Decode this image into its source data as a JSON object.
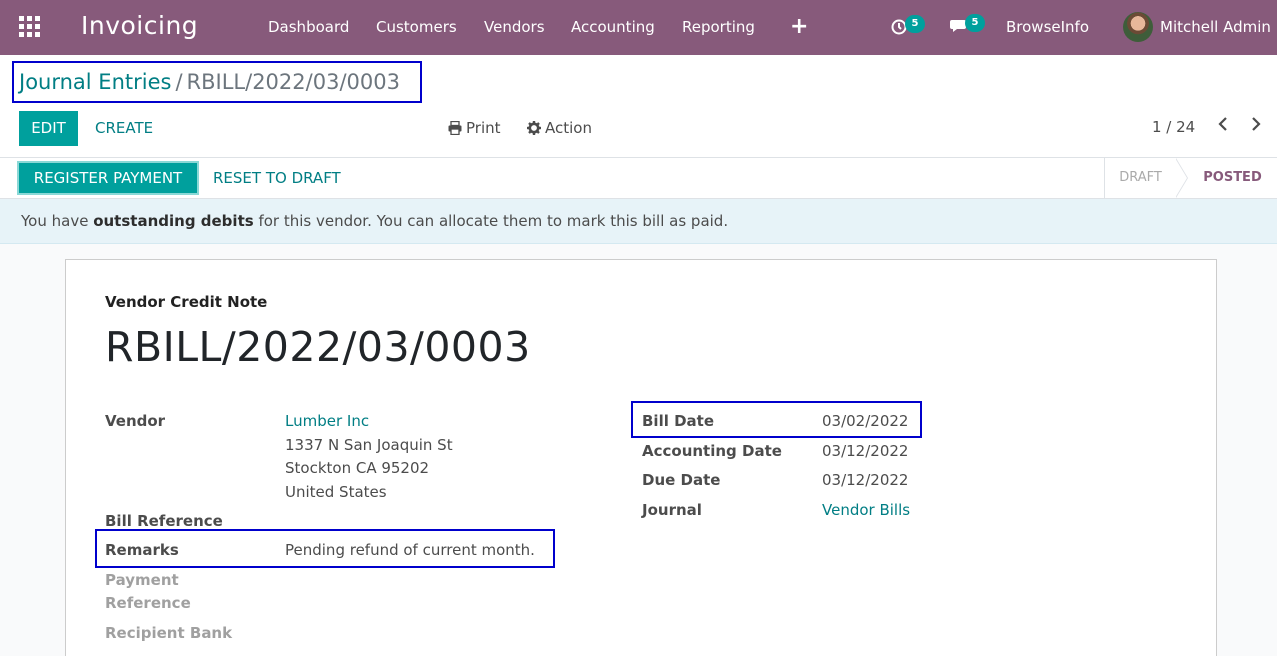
{
  "navbar": {
    "app_title": "Invoicing",
    "menu": [
      "Dashboard",
      "Customers",
      "Vendors",
      "Accounting",
      "Reporting"
    ],
    "activity_count": "5",
    "messages_count": "5",
    "company": "BrowseInfo",
    "user": "Mitchell Admin"
  },
  "breadcrumb": {
    "parent": "Journal Entries",
    "separator": "/",
    "current": "RBILL/2022/03/0003"
  },
  "buttons": {
    "edit": "EDIT",
    "create": "CREATE",
    "print": "Print",
    "action": "Action"
  },
  "pager": {
    "value": "1 / 24"
  },
  "statusbar": {
    "register_payment": "REGISTER PAYMENT",
    "reset_to_draft": "RESET TO DRAFT",
    "stages": [
      "DRAFT",
      "POSTED"
    ],
    "active_stage": "POSTED"
  },
  "alert": {
    "prefix": "You have ",
    "bold": "outstanding debits",
    "suffix": " for this vendor. You can allocate them to mark this bill as paid."
  },
  "document": {
    "type": "Vendor Credit Note",
    "name": "RBILL/2022/03/0003",
    "left": {
      "vendor_label": "Vendor",
      "vendor_name": "Lumber Inc",
      "address_line1": "1337 N San Joaquin St",
      "address_line2": "Stockton CA 95202",
      "address_line3": "United States",
      "bill_reference_label": "Bill Reference",
      "remarks_label": "Remarks",
      "remarks_value": "Pending refund of current month.",
      "payment_reference_label_1": "Payment",
      "payment_reference_label_2": "Reference",
      "recipient_bank_label": "Recipient Bank"
    },
    "right": {
      "bill_date_label": "Bill Date",
      "bill_date": "03/02/2022",
      "accounting_date_label": "Accounting Date",
      "accounting_date": "03/12/2022",
      "due_date_label": "Due Date",
      "due_date": "03/12/2022",
      "journal_label": "Journal",
      "journal": "Vendor Bills"
    }
  },
  "colors": {
    "navbar": "#875a7b",
    "primary": "#00a09d",
    "link": "#017e84",
    "highlight_box": "#0000cc"
  }
}
